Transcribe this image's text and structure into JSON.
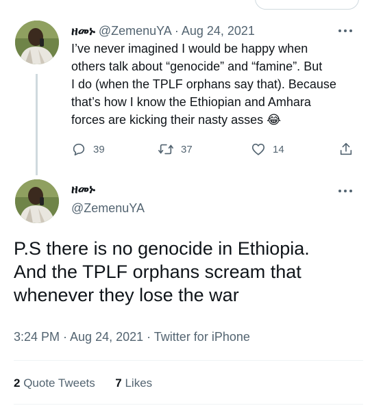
{
  "tweet1": {
    "display_name": "ዘመኑ",
    "handle": "@ZemenuYA",
    "separator": "·",
    "date": "Aug 24, 2021",
    "text_lines": [
      "I’ve never imagined I would be happy when",
      "others talk about “genocide” and “famine”. But",
      "I do (when the TPLF orphans say that). Because",
      "that’s how I know the Ethiopian and Amhara",
      "forces are kicking their nasty asses"
    ],
    "emoji": "😂",
    "actions": {
      "reply_count": "39",
      "retweet_count": "37",
      "like_count": "14"
    }
  },
  "tweet2": {
    "display_name": "ዘመኑ",
    "handle": "@ZemenuYA",
    "text_lines": [
      "P.S there is no genocide in Ethiopia.",
      "And the TPLF orphans scream that",
      "whenever they lose the war"
    ],
    "timestamp": "3:24 PM · Aug 24, 2021 · Twitter for iPhone",
    "stats": {
      "quote_count": "2",
      "quote_label": "Quote Tweets",
      "like_count": "7",
      "like_label": "Likes"
    }
  },
  "colors": {
    "text_primary": "#0f1419",
    "text_secondary": "#536471",
    "divider": "#eff3f4",
    "thread_line": "#cfd9de"
  },
  "icons": [
    "reply-icon",
    "retweet-icon",
    "like-icon",
    "share-icon",
    "more-icon"
  ]
}
